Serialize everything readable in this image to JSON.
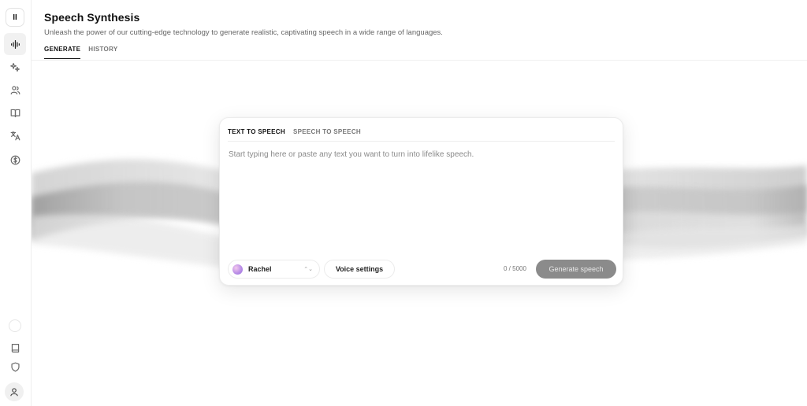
{
  "app": {
    "logo_glyph": "II"
  },
  "sidebar": {
    "items": [
      {
        "name": "speech-synthesis",
        "icon": "waveform-icon",
        "active": true
      },
      {
        "name": "voice-lab",
        "icon": "sparkles-icon",
        "active": false
      },
      {
        "name": "voices",
        "icon": "users-icon",
        "active": false
      },
      {
        "name": "projects",
        "icon": "book-open-icon",
        "active": false
      },
      {
        "name": "dubbing",
        "icon": "translate-icon",
        "active": false
      },
      {
        "name": "subscription",
        "icon": "coin-icon",
        "active": false
      }
    ],
    "bottom_items": [
      {
        "name": "docs",
        "icon": "book-icon"
      },
      {
        "name": "privacy",
        "icon": "shield-icon"
      },
      {
        "name": "account",
        "icon": "user-icon"
      }
    ]
  },
  "header": {
    "title": "Speech Synthesis",
    "subtitle": "Unleash the power of our cutting-edge technology to generate realistic, captivating speech in a wide range of languages.",
    "tabs": [
      {
        "label": "GENERATE",
        "active": true
      },
      {
        "label": "HISTORY",
        "active": false
      }
    ]
  },
  "card": {
    "tabs": [
      {
        "label": "TEXT TO SPEECH",
        "active": true
      },
      {
        "label": "SPEECH TO SPEECH",
        "active": false
      }
    ],
    "textarea": {
      "value": "",
      "placeholder": "Start typing here or paste any text you want to turn into lifelike speech."
    },
    "voice": {
      "name": "Rachel",
      "chevron": "⌃⌄"
    },
    "voice_settings_label": "Voice settings",
    "char_count": "0 / 5000",
    "generate_label": "Generate speech"
  },
  "colors": {
    "accent": "#111111",
    "generate_button_disabled": "#8b8b8b",
    "voice_avatar_gradient": [
      "#f4c9ee",
      "#b68ae6"
    ]
  }
}
